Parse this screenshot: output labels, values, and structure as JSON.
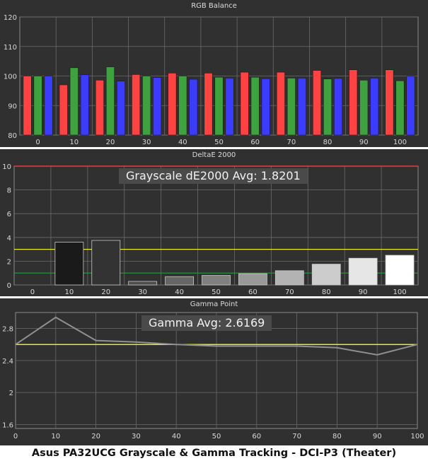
{
  "caption": "Asus PA32UCG Grayscale & Gamma Tracking - DCI-P3 (Theater)",
  "colors": {
    "panel_bg": "#303030",
    "red": "#ff4242",
    "green": "#3ea33e",
    "blue": "#3c3cff",
    "threshold_yellow": "#e8e82a",
    "threshold_green": "#2f9a2f",
    "limit_red": "#e04040",
    "gamma_target": "#e8e82a",
    "gamma_line": "#909090"
  },
  "chart_data": [
    {
      "type": "bar",
      "title": "RGB Balance",
      "categories": [
        "0",
        "10",
        "20",
        "30",
        "40",
        "50",
        "60",
        "70",
        "80",
        "90",
        "100"
      ],
      "ylim": [
        80,
        120
      ],
      "yticks": [
        "80",
        "90",
        "100",
        "110",
        "120"
      ],
      "grid": true,
      "series": [
        {
          "color": "red",
          "values": [
            100,
            97,
            98.6,
            100.5,
            101,
            101,
            101.3,
            101.3,
            101.9,
            102.1,
            102.1
          ]
        },
        {
          "color": "green",
          "values": [
            100,
            102.8,
            103.1,
            100,
            100,
            99.6,
            99.6,
            99.3,
            99,
            98.6,
            98.4
          ]
        },
        {
          "color": "blue",
          "values": [
            100,
            100.4,
            98.3,
            99.5,
            98.9,
            99.3,
            99.1,
            99.3,
            99.2,
            99.3,
            99.9
          ]
        }
      ]
    },
    {
      "type": "bar",
      "title": "DeltaE 2000",
      "annotation": "Grayscale dE2000 Avg: 1.8201",
      "categories": [
        "0",
        "10",
        "20",
        "30",
        "40",
        "50",
        "60",
        "70",
        "80",
        "90",
        "100"
      ],
      "values": [
        0,
        3.6,
        3.75,
        0.3,
        0.7,
        0.8,
        0.95,
        1.2,
        1.75,
        2.25,
        2.5
      ],
      "ylim": [
        0,
        10
      ],
      "yticks": [
        "0",
        "2",
        "4",
        "6",
        "8",
        "10"
      ],
      "thresholds": [
        3,
        1,
        10
      ],
      "grid": true
    },
    {
      "type": "line",
      "title": "Gamma Point",
      "annotation": "Gamma Avg: 2.6169",
      "x": [
        0,
        10,
        20,
        30,
        40,
        50,
        60,
        70,
        80,
        90,
        100
      ],
      "y": [
        2.6,
        2.94,
        2.65,
        2.63,
        2.6,
        2.58,
        2.58,
        2.58,
        2.56,
        2.47,
        2.6
      ],
      "target": 2.6,
      "xlim": [
        0,
        100
      ],
      "ylim": [
        1.55,
        3.0
      ],
      "yticks": [
        "1.6",
        "2",
        "2.4",
        "2.8"
      ],
      "xticks": [
        "0",
        "10",
        "20",
        "30",
        "40",
        "50",
        "60",
        "70",
        "80",
        "90",
        "100"
      ],
      "grid": true
    }
  ]
}
